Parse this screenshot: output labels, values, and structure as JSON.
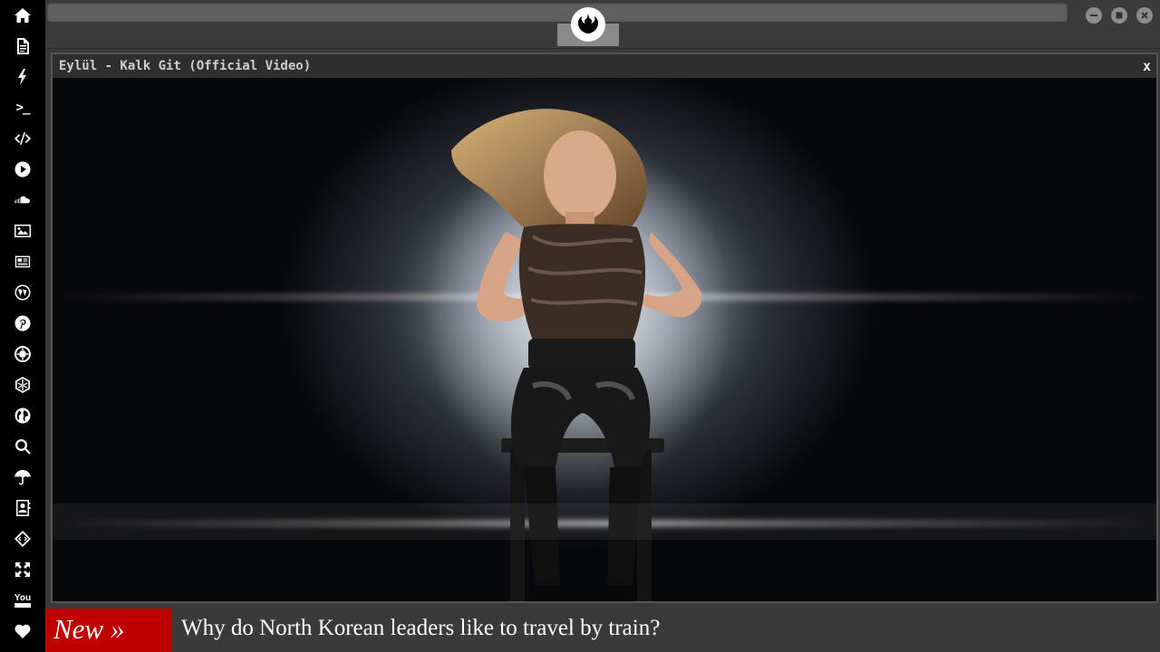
{
  "window": {
    "minimize_icon": "minus-icon",
    "maximize_icon": "square-icon",
    "close_icon": "x-icon"
  },
  "sidebar": {
    "items": [
      {
        "icon": "home-icon"
      },
      {
        "icon": "document-icon"
      },
      {
        "icon": "lightning-icon"
      },
      {
        "icon": "terminal-icon",
        "label": ">_"
      },
      {
        "icon": "code-icon"
      },
      {
        "icon": "play-circle-icon"
      },
      {
        "icon": "soundcloud-icon"
      },
      {
        "icon": "image-icon"
      },
      {
        "icon": "newspaper-icon"
      },
      {
        "icon": "wordpress-icon"
      },
      {
        "icon": "pinterest-icon"
      },
      {
        "icon": "galactic-empire-icon"
      },
      {
        "icon": "hexagon-icon"
      },
      {
        "icon": "globe-icon"
      },
      {
        "icon": "search-icon"
      },
      {
        "icon": "umbrella-icon"
      },
      {
        "icon": "contact-card-icon"
      },
      {
        "icon": "diamond-code-icon"
      },
      {
        "icon": "expand-icon"
      },
      {
        "icon": "youtube-icon",
        "label": "You"
      },
      {
        "icon": "heart-icon"
      }
    ]
  },
  "topbar": {
    "logo_icon": "rebel-alliance-icon"
  },
  "player": {
    "title": "Eylül - Kalk Git (Official Video)",
    "close_label": "x"
  },
  "ticker": {
    "badge": "New »",
    "headline": "Why do North Korean leaders like to travel by train?",
    "badge_color": "#c00000"
  }
}
